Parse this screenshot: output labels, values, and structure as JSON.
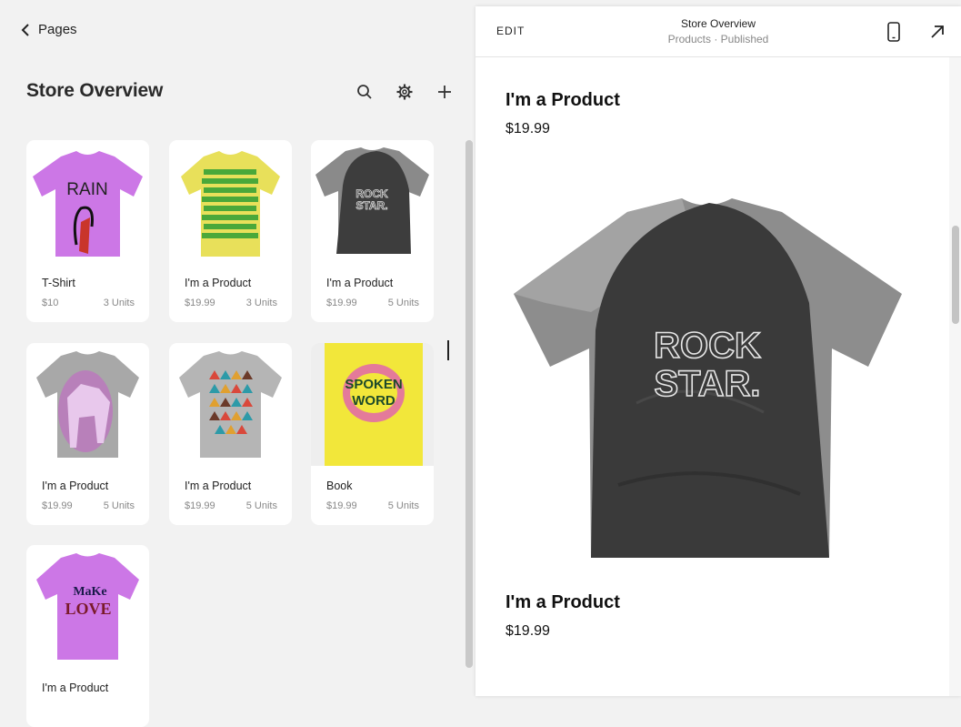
{
  "nav": {
    "back_label": "Pages"
  },
  "panel": {
    "title": "Store Overview"
  },
  "products": [
    {
      "name": "T-Shirt",
      "price": "$10",
      "units": "3 Units",
      "art": "rain-tshirt",
      "shirt_color": "#cc77e6"
    },
    {
      "name": "I'm a Product",
      "price": "$19.99",
      "units": "3 Units",
      "art": "lorem-tshirt",
      "shirt_color": "#e8e05a"
    },
    {
      "name": "I'm a Product",
      "price": "$19.99",
      "units": "5 Units",
      "art": "rockstar-tshirt",
      "shirt_color": "#8a8a8a"
    },
    {
      "name": "I'm a Product",
      "price": "$19.99",
      "units": "5 Units",
      "art": "wolf-tshirt",
      "shirt_color": "#a8a8a8"
    },
    {
      "name": "I'm a Product",
      "price": "$19.99",
      "units": "5 Units",
      "art": "triangles-tshirt",
      "shirt_color": "#b5b5b5"
    },
    {
      "name": "Book",
      "price": "$19.99",
      "units": "5 Units",
      "art": "spoken-word-book",
      "shirt_color": "#f2e73a"
    },
    {
      "name": "I'm a Product",
      "price": "",
      "units": "",
      "art": "make-love-tshirt",
      "shirt_color": "#cc77e6"
    }
  ],
  "preview": {
    "edit_label": "EDIT",
    "title": "Store Overview",
    "subtitle": "Products · Published",
    "items": [
      {
        "name": "I'm a Product",
        "price": "$19.99"
      },
      {
        "name": "I'm a Product",
        "price": "$19.99"
      }
    ],
    "shirt_text": [
      "ROCK",
      "STAR."
    ]
  },
  "art_text": {
    "rain": "RAIN",
    "rock_small": [
      "ROCK",
      "STAR."
    ],
    "book": [
      "SPOKEN",
      "WORD"
    ],
    "make_love": [
      "MaKe",
      "LOVE"
    ]
  }
}
